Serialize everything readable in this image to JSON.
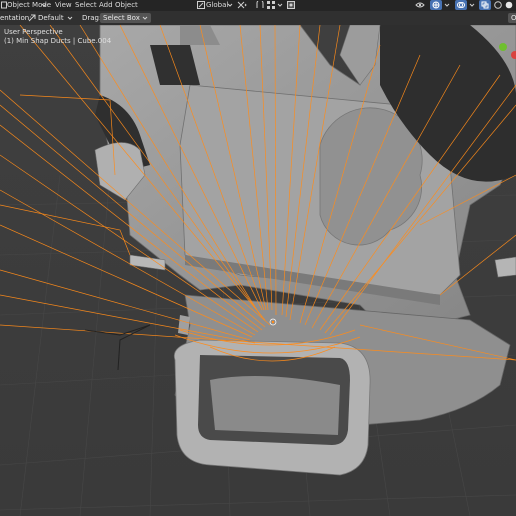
{
  "header": {
    "mode_label": "Object Mode",
    "menus": [
      "View",
      "Select",
      "Add",
      "Object"
    ],
    "transform_orientation": "Global"
  },
  "toolbar": {
    "orientation_label": "entation:",
    "orientation_value": "Default",
    "drag_label": "Drag:",
    "drag_value": "Select Box"
  },
  "viewport": {
    "view_name": "User Perspective",
    "object_info": "(1) Min Shap Ducts | Cube.004",
    "selection_color": "#ff8c1a",
    "mesh_color": "#9a9a9a"
  },
  "icons": [
    "object-mode-icon",
    "transform-pivot-icon",
    "snap-icon",
    "proportional-icon",
    "visibility-icon",
    "gizmo-icon",
    "overlay-icon",
    "xray-icon",
    "shading-solid-icon",
    "shading-material-icon"
  ]
}
